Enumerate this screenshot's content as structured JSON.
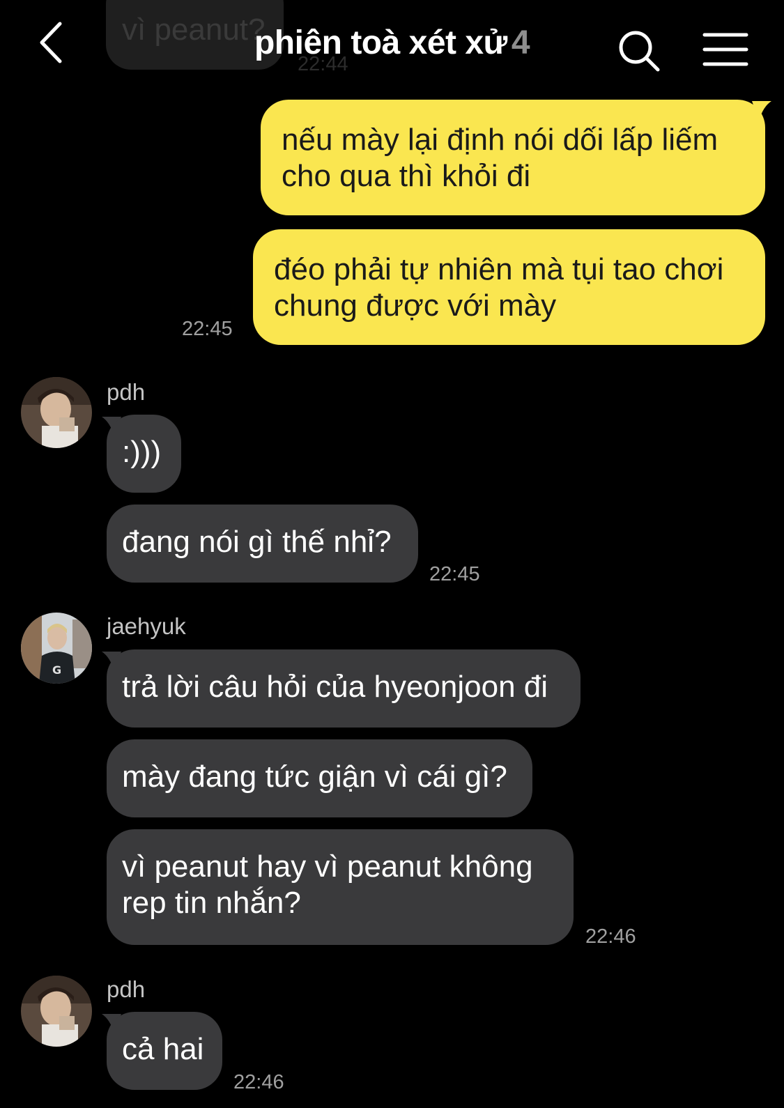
{
  "header": {
    "title": "phiên toà xét xử",
    "member_count": "4",
    "back_icon": "chevron-left-icon",
    "search_icon": "search-icon",
    "menu_icon": "hamburger-menu-icon"
  },
  "colors": {
    "background": "#000000",
    "my_bubble": "#fae650",
    "their_bubble": "#3a3a3c",
    "timestamp": "#a0a0a0"
  },
  "previous_message": {
    "text": "vì peanut?",
    "time": "22:44"
  },
  "messages": [
    {
      "type": "outgoing",
      "bubbles": [
        {
          "lines": [
            "nếu mày lại định nói dối lấp liếm",
            "cho qua thì khỏi đi"
          ]
        },
        {
          "lines": [
            "đéo phải tự nhiên mà tụi tao chơi",
            "chung được với mày"
          ]
        }
      ],
      "time": "22:45"
    },
    {
      "type": "incoming",
      "sender": "pdh",
      "bubbles": [
        {
          "lines": [
            ":)))"
          ]
        },
        {
          "lines": [
            "đang nói gì thế nhỉ?"
          ]
        }
      ],
      "time": "22:45"
    },
    {
      "type": "incoming",
      "sender": "jaehyuk",
      "bubbles": [
        {
          "lines": [
            "trả lời câu hỏi của hyeonjoon đi"
          ]
        },
        {
          "lines": [
            "mày đang tức giận vì cái gì?"
          ]
        },
        {
          "lines": [
            "vì peanut hay vì peanut không",
            "rep tin nhắn?"
          ]
        }
      ],
      "time": "22:46"
    },
    {
      "type": "incoming",
      "sender": "pdh",
      "bubbles": [
        {
          "lines": [
            "cả hai"
          ]
        }
      ],
      "time": "22:46"
    }
  ]
}
